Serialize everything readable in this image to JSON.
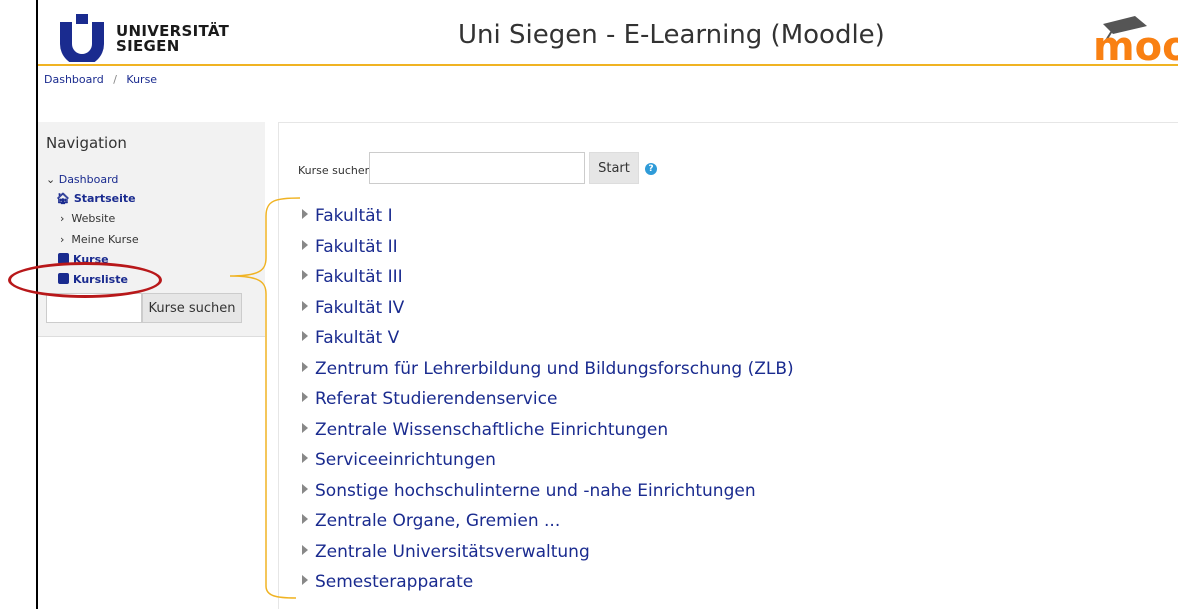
{
  "header": {
    "logo_line1": "UNIVERSITÄT",
    "logo_line2": "SIEGEN",
    "site_title": "Uni Siegen - E-Learning (Moodle)",
    "moodle_logo_text": "moo"
  },
  "breadcrumb": {
    "items": [
      "Dashboard",
      "Kurse"
    ],
    "separator": "/"
  },
  "navigation": {
    "title": "Navigation",
    "dashboard": "Dashboard",
    "startseite": "Startseite",
    "website": "Website",
    "meine_kurse": "Meine Kurse",
    "kurse": "Kurse",
    "kursliste": "Kursliste",
    "search_button": "Kurse suchen"
  },
  "search": {
    "label": "Kurse suchen",
    "button": "Start",
    "help": "?"
  },
  "categories": [
    "Fakultät I",
    "Fakultät II",
    "Fakultät III",
    "Fakultät IV",
    "Fakultät V",
    "Zentrum für Lehrerbildung und Bildungsforschung (ZLB)",
    "Referat Studierendenservice",
    "Zentrale Wissenschaftliche Einrichtungen",
    "Serviceeinrichtungen",
    "Sonstige hochschulinterne und -nahe Einrichtungen",
    "Zentrale Organe, Gremien ...",
    "Zentrale Universitätsverwaltung",
    "Semesterapparate"
  ],
  "colors": {
    "link": "#1a2b8f",
    "accent": "#f0b323",
    "highlight": "#b8181a",
    "moodle_orange": "#f98012"
  }
}
